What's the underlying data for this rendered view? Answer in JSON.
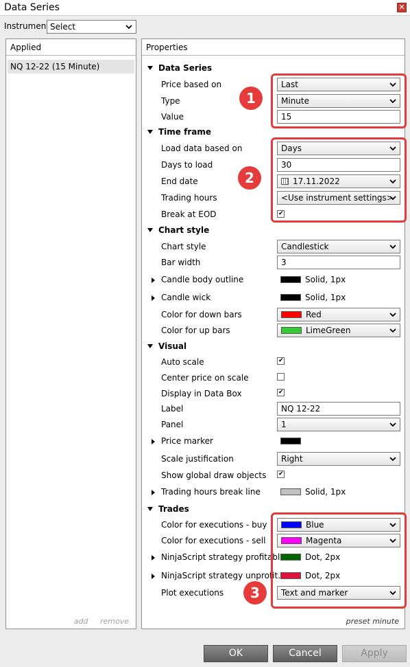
{
  "window": {
    "title": "Data Series",
    "close_glyph": "✕"
  },
  "instrument": {
    "label": "Instrument",
    "value": "Select"
  },
  "applied": {
    "header": "Applied",
    "items": [
      "NQ 12-22 (15 Minute)"
    ],
    "add_label": "add",
    "remove_label": "remove"
  },
  "properties": {
    "header": "Properties",
    "footer": "preset minute",
    "data_series": {
      "title": "Data Series",
      "price_based_on": {
        "label": "Price based on",
        "value": "Last"
      },
      "type": {
        "label": "Type",
        "value": "Minute"
      },
      "value": {
        "label": "Value",
        "value": "15"
      }
    },
    "time_frame": {
      "title": "Time frame",
      "load_data_based_on": {
        "label": "Load data based on",
        "value": "Days"
      },
      "days_to_load": {
        "label": "Days to load",
        "value": "30"
      },
      "end_date": {
        "label": "End date",
        "value": "17.11.2022"
      },
      "trading_hours": {
        "label": "Trading hours",
        "value": "<Use instrument settings>"
      },
      "break_at_eod": {
        "label": "Break at EOD",
        "checked": true
      }
    },
    "chart_style": {
      "title": "Chart style",
      "chart_style": {
        "label": "Chart style",
        "value": "Candlestick"
      },
      "bar_width": {
        "label": "Bar width",
        "value": "3"
      },
      "candle_body_outline": {
        "label": "Candle body outline",
        "value": "Solid, 1px",
        "color": "#000000"
      },
      "candle_wick": {
        "label": "Candle wick",
        "value": "Solid, 1px",
        "color": "#000000"
      },
      "color_down_bars": {
        "label": "Color for down bars",
        "value": "Red",
        "color": "#ff0000"
      },
      "color_up_bars": {
        "label": "Color for up bars",
        "value": "LimeGreen",
        "color": "#32cd32"
      }
    },
    "visual": {
      "title": "Visual",
      "auto_scale": {
        "label": "Auto scale",
        "checked": true
      },
      "center_price": {
        "label": "Center price on scale",
        "checked": false
      },
      "display_in_data_box": {
        "label": "Display in Data Box",
        "checked": true
      },
      "label": {
        "label": "Label",
        "value": "NQ 12-22"
      },
      "panel": {
        "label": "Panel",
        "value": "1"
      },
      "price_marker": {
        "label": "Price marker",
        "color": "#000000"
      },
      "scale_justification": {
        "label": "Scale justification",
        "value": "Right"
      },
      "show_global_draw": {
        "label": "Show global draw objects",
        "checked": true
      },
      "trading_hours_break_line": {
        "label": "Trading hours break line",
        "value": "Solid, 1px",
        "color": "#c0c0c0"
      }
    },
    "trades": {
      "title": "Trades",
      "exec_buy": {
        "label": "Color for executions - buy",
        "value": "Blue",
        "color": "#0000ff"
      },
      "exec_sell": {
        "label": "Color for executions - sell",
        "value": "Magenta",
        "color": "#ff00ff"
      },
      "strategy_profitable": {
        "label": "NinjaScript strategy profitabl...",
        "value": "Dot, 2px",
        "color": "#006400"
      },
      "strategy_unprofitable": {
        "label": "NinjaScript strategy unprofit...",
        "value": "Dot, 2px",
        "color": "#dc143c"
      },
      "plot_executions": {
        "label": "Plot executions",
        "value": "Text and marker"
      }
    }
  },
  "annotations": {
    "badge1": "1",
    "badge2": "2",
    "badge3": "3",
    "highlight_color": "#e53b3b"
  },
  "buttons": {
    "ok": "OK",
    "cancel": "Cancel",
    "apply": "Apply"
  }
}
